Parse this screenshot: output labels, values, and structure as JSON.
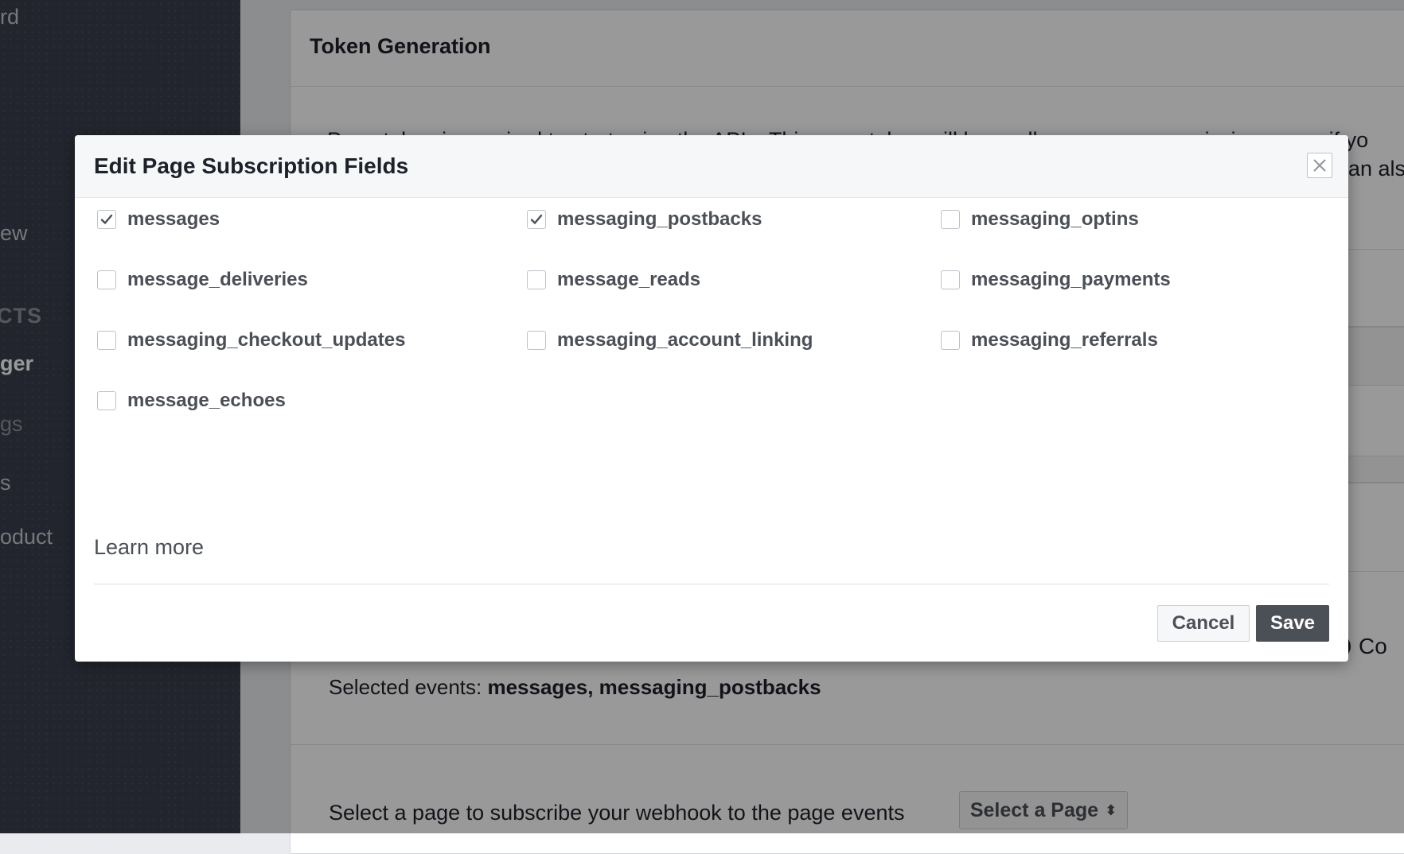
{
  "sidebar": {
    "items": [
      {
        "label": "rd"
      },
      {
        "label": "ew"
      },
      {
        "label": "CTS"
      },
      {
        "label": "ger"
      },
      {
        "label": "gs"
      },
      {
        "label": "s"
      },
      {
        "label": "oduct"
      }
    ]
  },
  "background": {
    "card_title": "Token Generation",
    "paragraph_line1": "Page token is required to start using the APIs. This page token will have all messenger permissions even if yo",
    "paragraph_line2": "an also",
    "selected_events_label": "Selected events:",
    "selected_events_value": "messages, messaging_postbacks",
    "select_page_prompt": "Select a page to subscribe your webhook to the page events",
    "select_page_button": "Select a Page",
    "select_page_arrows": "⬍",
    "confirm_text": "Co"
  },
  "modal": {
    "title": "Edit Page Subscription Fields",
    "close_icon": "close-icon",
    "fields": [
      {
        "label": "messages",
        "checked": true
      },
      {
        "label": "messaging_postbacks",
        "checked": true
      },
      {
        "label": "messaging_optins",
        "checked": false
      },
      {
        "label": "message_deliveries",
        "checked": false
      },
      {
        "label": "message_reads",
        "checked": false
      },
      {
        "label": "messaging_payments",
        "checked": false
      },
      {
        "label": "messaging_checkout_updates",
        "checked": false
      },
      {
        "label": "messaging_account_linking",
        "checked": false
      },
      {
        "label": "messaging_referrals",
        "checked": false
      },
      {
        "label": "message_echoes",
        "checked": false
      }
    ],
    "learn_more": "Learn more",
    "cancel_label": "Cancel",
    "save_label": "Save"
  },
  "colors": {
    "sidebar_bg": "#3a3f4b",
    "primary_button": "#4b4f56",
    "text_dark": "#1d2129",
    "text_muted": "#4b4f56"
  }
}
